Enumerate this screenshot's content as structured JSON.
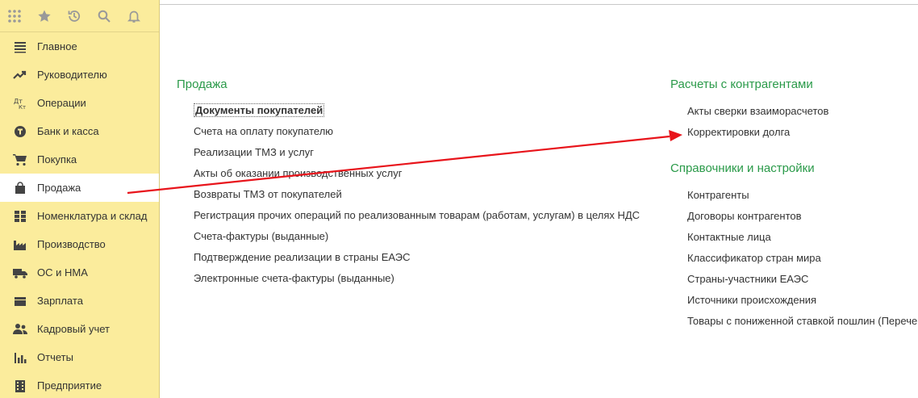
{
  "sidebar": {
    "toolbar": [
      {
        "name": "apps-grid-icon"
      },
      {
        "name": "star-icon"
      },
      {
        "name": "history-icon"
      },
      {
        "name": "search-icon"
      },
      {
        "name": "bell-icon"
      }
    ],
    "items": [
      {
        "label": "Главное",
        "icon": "menu-lines-icon"
      },
      {
        "label": "Руководителю",
        "icon": "trend-icon"
      },
      {
        "label": "Операции",
        "icon": "dt-kt-icon"
      },
      {
        "label": "Банк и касса",
        "icon": "coin-icon"
      },
      {
        "label": "Покупка",
        "icon": "cart-icon"
      },
      {
        "label": "Продажа",
        "icon": "bag-icon",
        "active": true
      },
      {
        "label": "Номенклатура и склад",
        "icon": "grid-icon"
      },
      {
        "label": "Производство",
        "icon": "factory-icon"
      },
      {
        "label": "ОС и НМА",
        "icon": "truck-icon"
      },
      {
        "label": "Зарплата",
        "icon": "wallet-icon"
      },
      {
        "label": "Кадровый учет",
        "icon": "people-icon"
      },
      {
        "label": "Отчеты",
        "icon": "bar-chart-icon"
      },
      {
        "label": "Предприятие",
        "icon": "building-icon"
      }
    ]
  },
  "sales": {
    "title": "Продажа",
    "items": [
      "Документы покупателей",
      "Счета на оплату покупателю",
      "Реализации ТМЗ и услуг",
      "Акты об оказании производственных услуг",
      "Возвраты ТМЗ от покупателей",
      "Регистрация прочих операций по реализованным товарам (работам, услугам) в целях НДС",
      "Счета-фактуры (выданные)",
      "Подтверждение реализации в страны ЕАЭС",
      "Электронные счета-фактуры (выданные)"
    ]
  },
  "settlements": {
    "title": "Расчеты с контрагентами",
    "items": [
      "Акты сверки взаиморасчетов",
      "Корректировки долга"
    ]
  },
  "references": {
    "title": "Справочники и настройки",
    "items": [
      "Контрагенты",
      "Договоры контрагентов",
      "Контактные лица",
      "Классификатор стран мира",
      "Страны-участники ЕАЭС",
      "Источники происхождения",
      "Товары с пониженной ставкой пошлин (Перечен"
    ]
  },
  "colors": {
    "sidebar_bg": "#fbec9c",
    "section_title": "#2a9a49",
    "annotation_arrow": "#e8141b"
  }
}
